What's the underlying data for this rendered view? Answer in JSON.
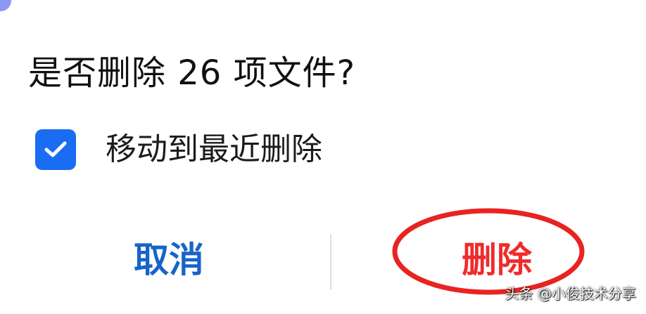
{
  "dialog": {
    "title": "是否删除 26 项文件?",
    "option": {
      "label": "移动到最近删除",
      "checked": true
    },
    "buttons": {
      "cancel": "取消",
      "delete": "删除"
    }
  },
  "annotation": {
    "shape": "red-ellipse",
    "target": "delete-button"
  },
  "watermark": "头条 @小俊技术分享",
  "colors": {
    "accent_blue": "#1a6df2",
    "cancel_text": "#1864c8",
    "danger_red": "#ef2b2b",
    "annotation_red": "#e82320",
    "title_text": "#111111"
  },
  "icons": {
    "checkbox": "checkmark-icon"
  }
}
